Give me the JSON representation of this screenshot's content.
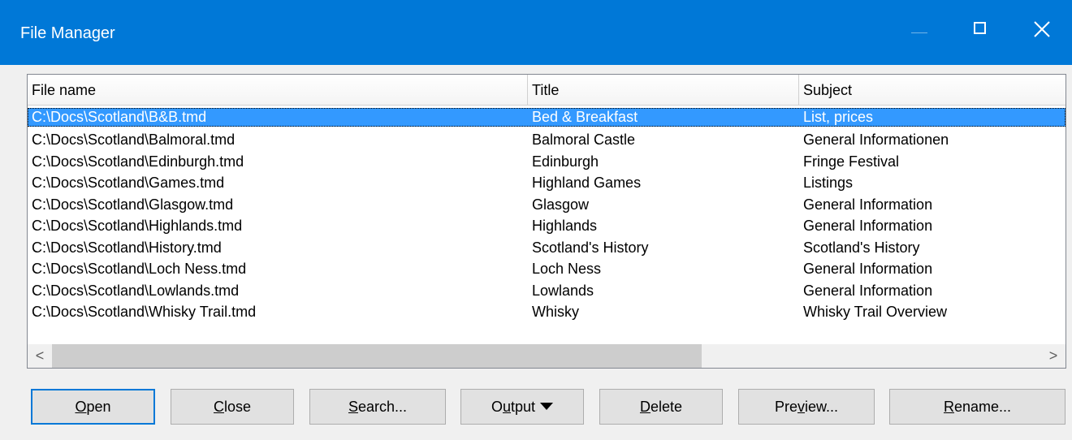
{
  "window": {
    "title": "File Manager",
    "minimize_icon": "minimize-icon",
    "maximize_icon": "maximize-icon",
    "close_icon": "close-icon"
  },
  "columns": {
    "file_name": "File name",
    "title": "Title",
    "subject": "Subject"
  },
  "files": [
    {
      "file": "C:\\Docs\\Scotland\\B&B.tmd",
      "title": "Bed & Breakfast",
      "subject": "List, prices",
      "selected": true
    },
    {
      "file": "C:\\Docs\\Scotland\\Balmoral.tmd",
      "title": "Balmoral Castle",
      "subject": "General Informationen",
      "selected": false
    },
    {
      "file": "C:\\Docs\\Scotland\\Edinburgh.tmd",
      "title": "Edinburgh",
      "subject": "Fringe Festival",
      "selected": false
    },
    {
      "file": "C:\\Docs\\Scotland\\Games.tmd",
      "title": "Highland Games",
      "subject": "Listings",
      "selected": false
    },
    {
      "file": "C:\\Docs\\Scotland\\Glasgow.tmd",
      "title": "Glasgow",
      "subject": "General Information",
      "selected": false
    },
    {
      "file": "C:\\Docs\\Scotland\\Highlands.tmd",
      "title": "Highlands",
      "subject": "General Information",
      "selected": false
    },
    {
      "file": "C:\\Docs\\Scotland\\History.tmd",
      "title": "Scotland's History",
      "subject": "Scotland's History",
      "selected": false
    },
    {
      "file": "C:\\Docs\\Scotland\\Loch Ness.tmd",
      "title": "Loch Ness",
      "subject": "General Information",
      "selected": false
    },
    {
      "file": "C:\\Docs\\Scotland\\Lowlands.tmd",
      "title": "Lowlands",
      "subject": "General Information",
      "selected": false
    },
    {
      "file": "C:\\Docs\\Scotland\\Whisky Trail.tmd",
      "title": "Whisky",
      "subject": "Whisky Trail Overview",
      "selected": false
    }
  ],
  "scrollbar": {
    "left_arrow": "<",
    "right_arrow": ">"
  },
  "buttons": {
    "open": {
      "mnemonic": "O",
      "rest": "pen"
    },
    "close": {
      "mnemonic": "C",
      "rest": "lose"
    },
    "search": {
      "mnemonic": "S",
      "rest": "earch..."
    },
    "output": {
      "pre": "O",
      "mnemonic": "u",
      "rest": "tput"
    },
    "delete": {
      "mnemonic": "D",
      "rest": "elete"
    },
    "preview": {
      "pre": "Pre",
      "mnemonic": "v",
      "rest": "iew..."
    },
    "rename": {
      "mnemonic": "R",
      "rest": "ename..."
    }
  },
  "colors": {
    "titlebar": "#0078d7",
    "selection": "#3399ff",
    "window_bg": "#f0f0f0"
  }
}
